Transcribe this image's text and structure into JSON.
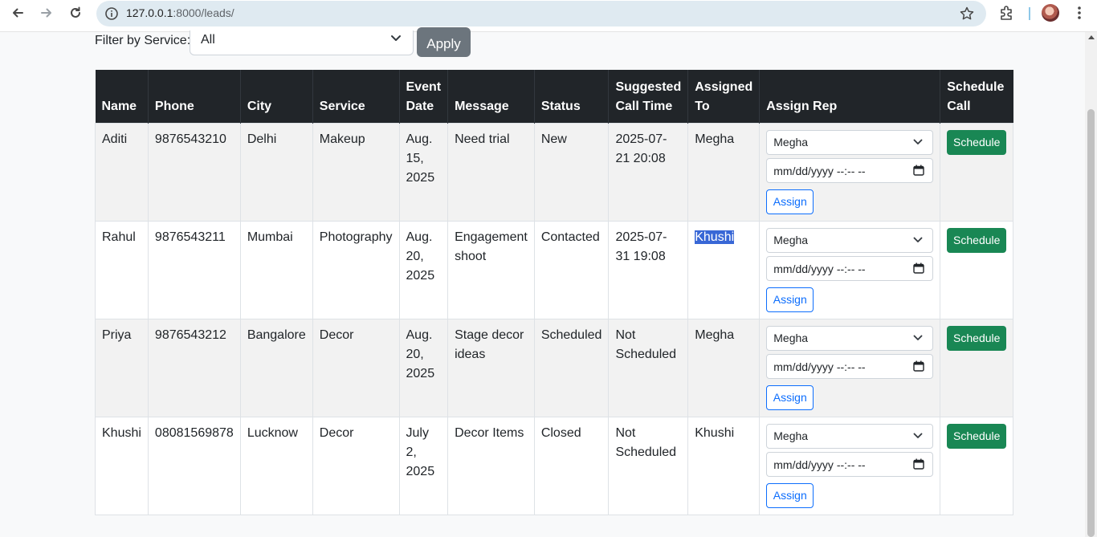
{
  "browser": {
    "url_host": "127.0.0.1",
    "url_rest": ":8000/leads/"
  },
  "filter": {
    "label": "Filter by Service:",
    "selected": "All",
    "apply_label": "Apply"
  },
  "table": {
    "headers": {
      "name": "Name",
      "phone": "Phone",
      "city": "City",
      "service": "Service",
      "event_date_1": "Event",
      "event_date_2": "Date",
      "message": "Message",
      "status": "Status",
      "suggested_1": "Suggested",
      "suggested_2": "Call Time",
      "assigned_1": "Assigned",
      "assigned_2": "To",
      "assign_rep": "Assign Rep",
      "schedule_1": "Schedule",
      "schedule_2": "Call"
    },
    "rows": [
      {
        "name": "Aditi",
        "phone": "9876543210",
        "city": "Delhi",
        "service": "Makeup",
        "date_1": "Aug.",
        "date_2": "15,",
        "date_3": "2025",
        "message_1": "Need trial",
        "message_2": "",
        "status": "New",
        "suggested_1": "2025-07-",
        "suggested_2": "21 20:08",
        "assigned_to": "Megha",
        "rep_selected": "Megha",
        "datetime_placeholder": "mm/dd/yyyy --:-- --",
        "assign_label": "Assign",
        "schedule_label": "Schedule"
      },
      {
        "name": "Rahul",
        "phone": "9876543211",
        "city": "Mumbai",
        "service": "Photography",
        "date_1": "Aug.",
        "date_2": "20,",
        "date_3": "2025",
        "message_1": "Engagement",
        "message_2": "shoot",
        "status": "Contacted",
        "suggested_1": "2025-07-",
        "suggested_2": "31 19:08",
        "assigned_to": "Khushi",
        "rep_selected": "Megha",
        "datetime_placeholder": "mm/dd/yyyy --:-- --",
        "assign_label": "Assign",
        "schedule_label": "Schedule"
      },
      {
        "name": "Priya",
        "phone": "9876543212",
        "city": "Bangalore",
        "service": "Decor",
        "date_1": "Aug.",
        "date_2": "20,",
        "date_3": "2025",
        "message_1": "Stage decor",
        "message_2": "ideas",
        "status": "Scheduled",
        "suggested_1": "Not",
        "suggested_2": "Scheduled",
        "assigned_to": "Megha",
        "rep_selected": "Megha",
        "datetime_placeholder": "mm/dd/yyyy --:-- --",
        "assign_label": "Assign",
        "schedule_label": "Schedule"
      },
      {
        "name": "Khushi",
        "phone": "08081569878",
        "city": "Lucknow",
        "service": "Decor",
        "date_1": "July",
        "date_2": "2,",
        "date_3": "2025",
        "message_1": "Decor Items",
        "message_2": "",
        "status": "Closed",
        "suggested_1": "Not",
        "suggested_2": "Scheduled",
        "assigned_to": "Khushi",
        "rep_selected": "Megha",
        "datetime_placeholder": "mm/dd/yyyy --:-- --",
        "assign_label": "Assign",
        "schedule_label": "Schedule"
      }
    ]
  },
  "colors": {
    "header_bg": "#212529",
    "apply_bg": "#6c757d",
    "schedule_bg": "#198754",
    "assign_border": "#0d6efd",
    "selection": "#3867d6"
  },
  "icons": {
    "back": "arrow-left-icon",
    "forward": "arrow-right-icon",
    "reload": "reload-icon",
    "info": "info-icon",
    "star": "star-icon",
    "extensions": "puzzle-icon",
    "menu": "kebab-menu-icon",
    "calendar": "calendar-icon",
    "chevron": "chevron-down-icon"
  }
}
